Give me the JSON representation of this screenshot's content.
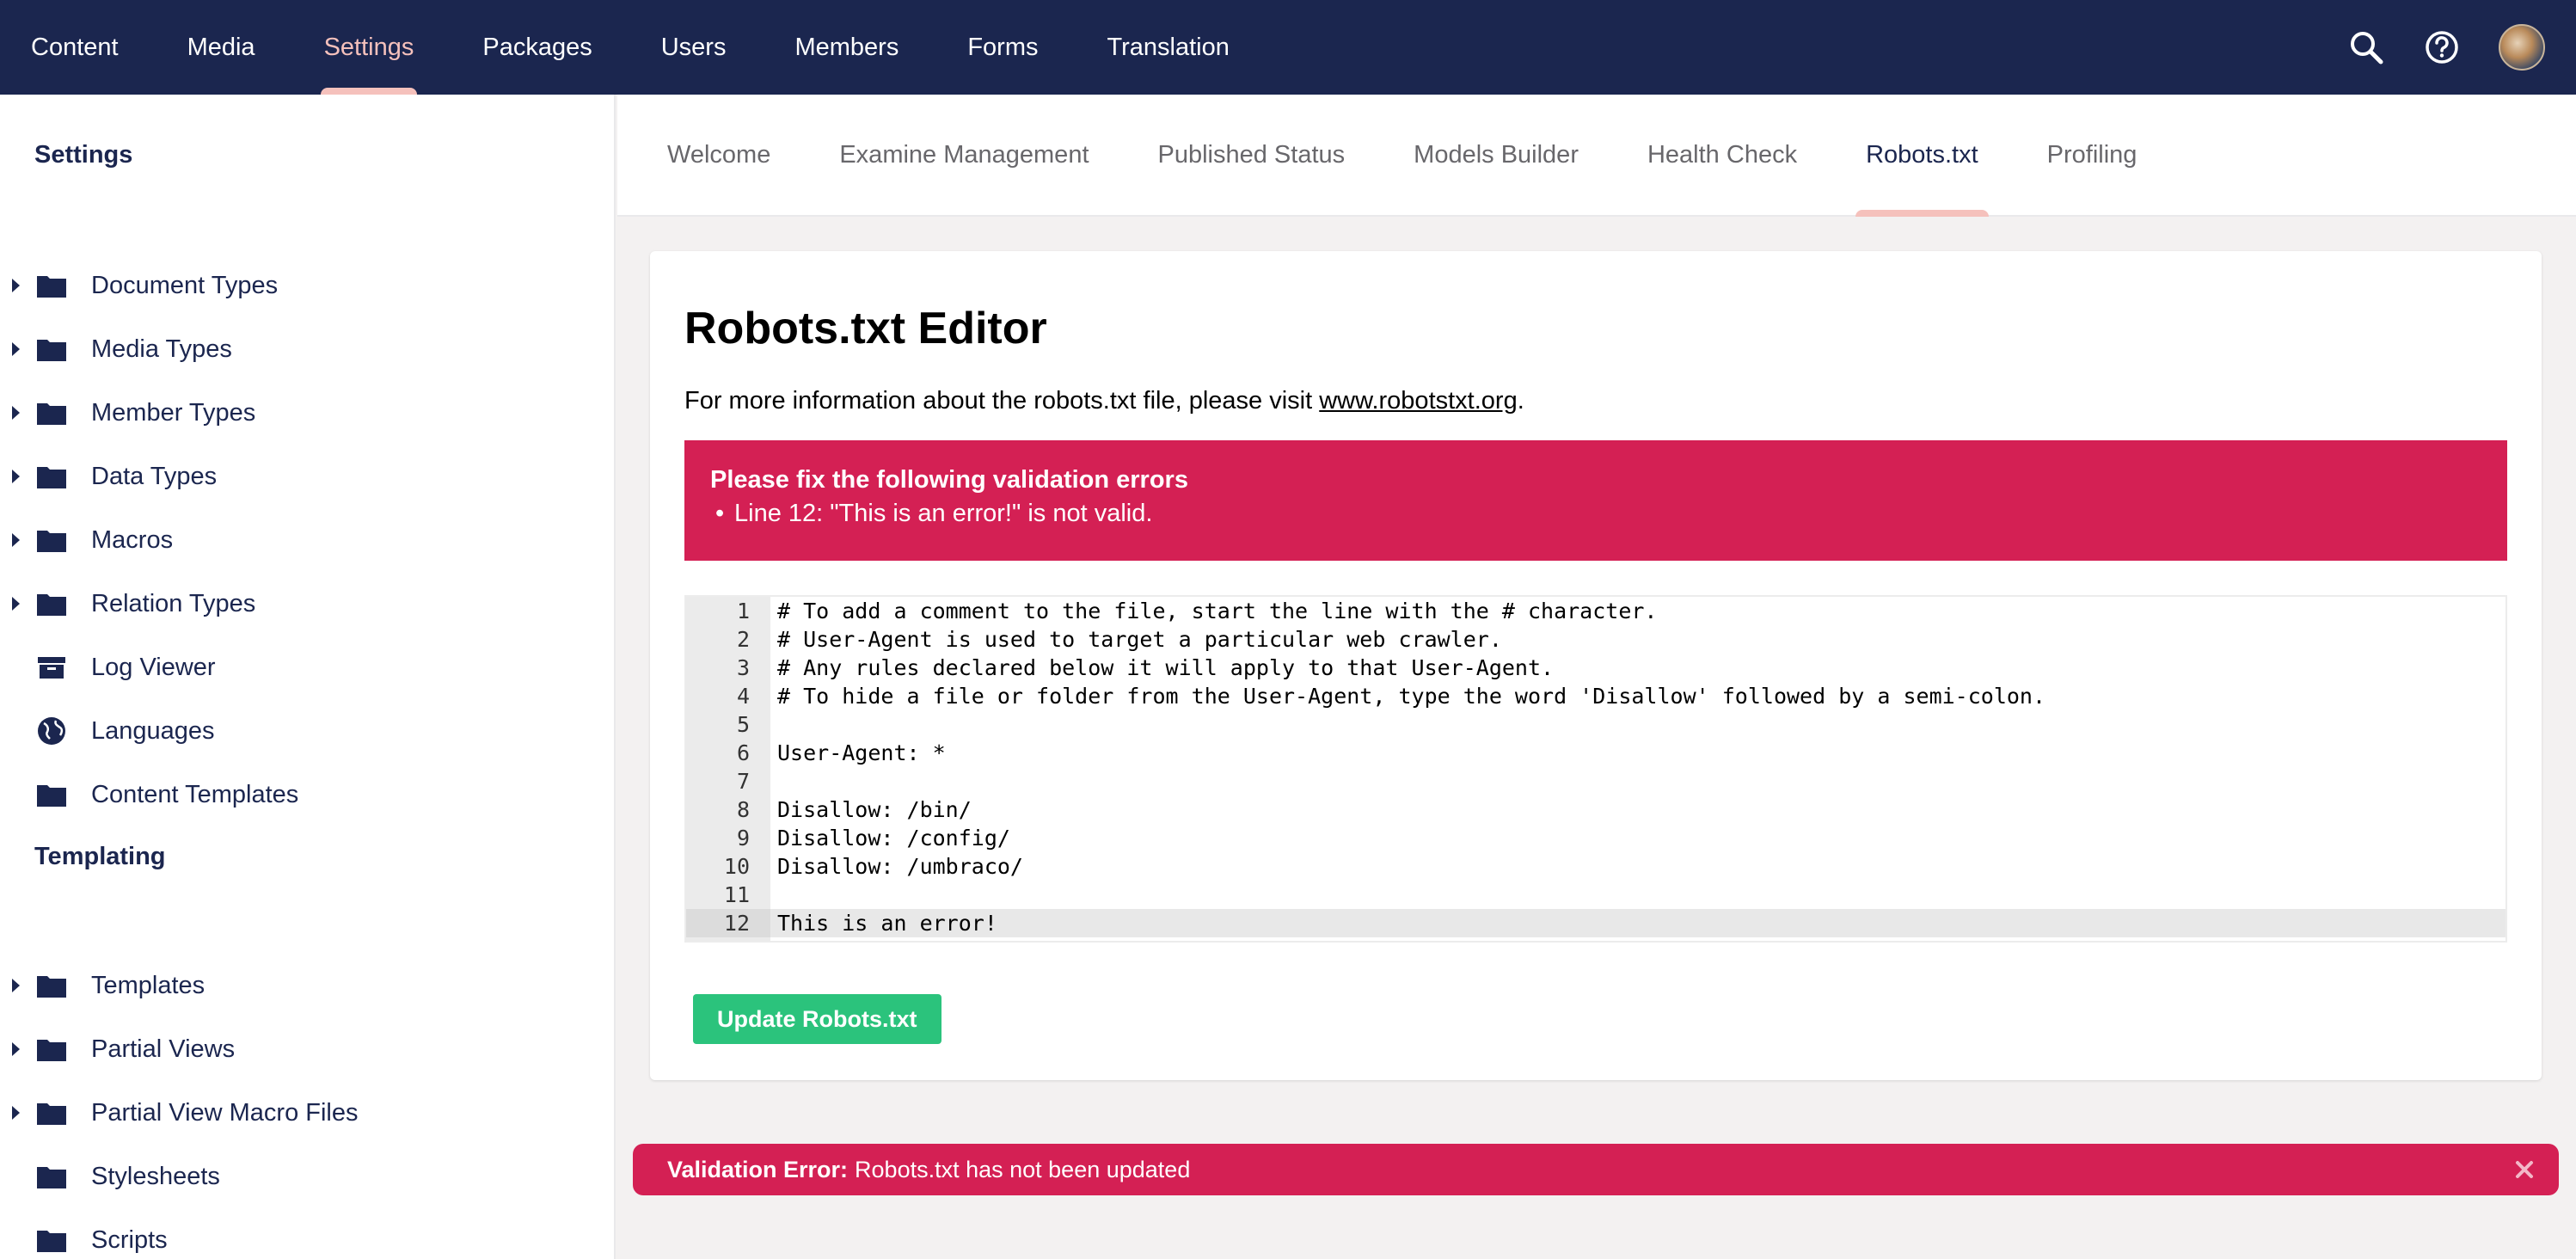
{
  "topnav": {
    "items": [
      {
        "label": "Content"
      },
      {
        "label": "Media"
      },
      {
        "label": "Settings"
      },
      {
        "label": "Packages"
      },
      {
        "label": "Users"
      },
      {
        "label": "Members"
      },
      {
        "label": "Forms"
      },
      {
        "label": "Translation"
      }
    ],
    "active": "Settings",
    "actions": [
      "search-icon",
      "help-icon",
      "avatar"
    ]
  },
  "sidebar": {
    "settings_title": "Settings",
    "settings_items": [
      {
        "label": "Document Types",
        "icon": "folder-icon",
        "expandable": true
      },
      {
        "label": "Media Types",
        "icon": "folder-icon",
        "expandable": true
      },
      {
        "label": "Member Types",
        "icon": "folder-icon",
        "expandable": true
      },
      {
        "label": "Data Types",
        "icon": "folder-icon",
        "expandable": true
      },
      {
        "label": "Macros",
        "icon": "folder-icon",
        "expandable": true
      },
      {
        "label": "Relation Types",
        "icon": "folder-icon",
        "expandable": true
      },
      {
        "label": "Log Viewer",
        "icon": "archive-icon",
        "expandable": false
      },
      {
        "label": "Languages",
        "icon": "globe-icon",
        "expandable": false
      },
      {
        "label": "Content Templates",
        "icon": "folder-icon",
        "expandable": false
      }
    ],
    "templating_title": "Templating",
    "templating_items": [
      {
        "label": "Templates",
        "icon": "folder-icon",
        "expandable": true
      },
      {
        "label": "Partial Views",
        "icon": "folder-icon",
        "expandable": true
      },
      {
        "label": "Partial View Macro Files",
        "icon": "folder-icon",
        "expandable": true
      },
      {
        "label": "Stylesheets",
        "icon": "folder-icon",
        "expandable": false
      },
      {
        "label": "Scripts",
        "icon": "folder-icon",
        "expandable": false
      }
    ]
  },
  "subtabs": {
    "items": [
      {
        "label": "Welcome"
      },
      {
        "label": "Examine Management"
      },
      {
        "label": "Published Status"
      },
      {
        "label": "Models Builder"
      },
      {
        "label": "Health Check"
      },
      {
        "label": "Robots.txt"
      },
      {
        "label": "Profiling"
      }
    ],
    "active": "Robots.txt"
  },
  "editor_panel": {
    "title": "Robots.txt Editor",
    "intro_prefix": "For more information about the robots.txt file, please visit ",
    "intro_link": "www.robotstxt.org",
    "intro_suffix": ".",
    "error_title": "Please fix the following validation errors",
    "errors": [
      "Line 12: \"This is an error!\" is not valid."
    ],
    "lines": [
      {
        "n": "1",
        "text": "# To add a comment to the file, start the line with the # character."
      },
      {
        "n": "2",
        "text": "# User-Agent is used to target a particular web crawler."
      },
      {
        "n": "3",
        "text": "# Any rules declared below it will apply to that User-Agent."
      },
      {
        "n": "4",
        "text": "# To hide a file or folder from the User-Agent, type the word 'Disallow' followed by a semi-colon."
      },
      {
        "n": "5",
        "text": ""
      },
      {
        "n": "6",
        "text": "User-Agent: *"
      },
      {
        "n": "7",
        "text": ""
      },
      {
        "n": "8",
        "text": "Disallow: /bin/"
      },
      {
        "n": "9",
        "text": "Disallow: /config/"
      },
      {
        "n": "10",
        "text": "Disallow: /umbraco/"
      },
      {
        "n": "11",
        "text": ""
      },
      {
        "n": "12",
        "text": "This is an error!"
      }
    ],
    "current_line": "12",
    "update_button": "Update Robots.txt"
  },
  "notification": {
    "label": "Validation Error:",
    "message": "Robots.txt has not been updated"
  },
  "colors": {
    "topbar": "#1b264f",
    "active_accent": "#f5c1bc",
    "error": "#d42054",
    "success": "#2bc37c"
  }
}
